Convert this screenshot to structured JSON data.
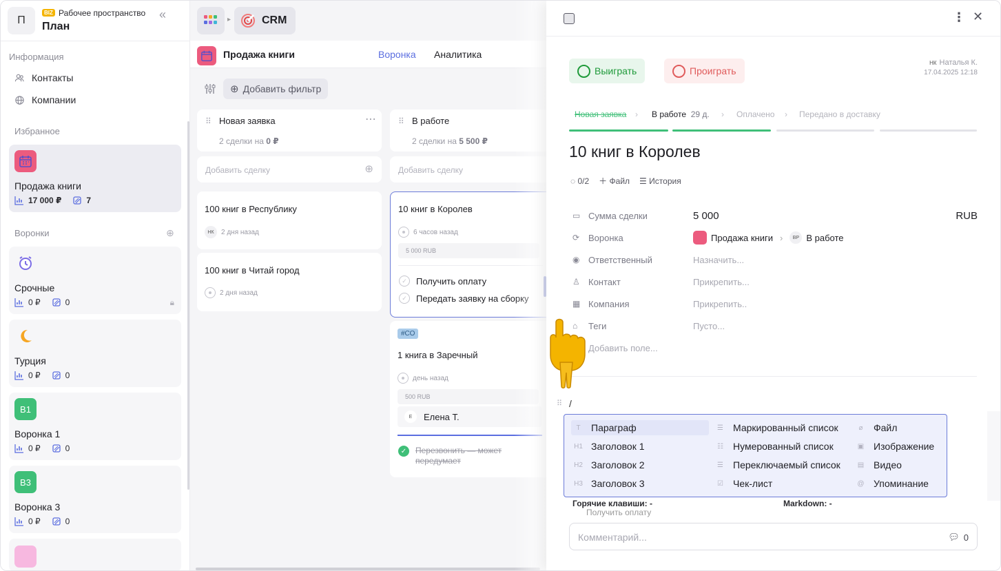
{
  "workspace": {
    "avatar": "П",
    "badge": "BIZ",
    "label": "Рабочее пространство",
    "name": "План"
  },
  "sidebar": {
    "info_section": "Информация",
    "nav": [
      {
        "label": "Контакты",
        "icon": "people-icon"
      },
      {
        "label": "Компании",
        "icon": "globe-icon"
      }
    ],
    "favorites_section": "Избранное",
    "favorite": {
      "name": "Продажа книги",
      "amount": "17 000 ₽",
      "count": "7"
    },
    "pipelines_section": "Воронки",
    "pipelines": [
      {
        "name": "Срочные",
        "amount": "0 ₽",
        "count": "0"
      },
      {
        "name": "Турция",
        "amount": "0 ₽",
        "count": "0"
      },
      {
        "name": "Воронка 1",
        "badge": "В1",
        "amount": "0 ₽",
        "count": "0"
      },
      {
        "name": "Воронка 3",
        "badge": "В3",
        "amount": "0 ₽",
        "count": "0"
      }
    ]
  },
  "topbar": {
    "app": "CRM"
  },
  "pipeline": {
    "title": "Продажа книги",
    "tabs": [
      "Воронка",
      "Аналитика"
    ]
  },
  "filter": {
    "add_label": "Добавить фильтр"
  },
  "columns": [
    {
      "title": "Новая заявка",
      "summary": "2 сделки на ",
      "summary_bold": "0 ₽",
      "add": "Добавить сделку",
      "deals": [
        {
          "title": "100 книг в Республику",
          "avatar": "НК",
          "time": "2 дня назад"
        },
        {
          "title": "100 книг в Читай город",
          "time": "2 дня назад"
        }
      ]
    },
    {
      "title": "В работе",
      "summary": "2 сделки на ",
      "summary_bold": "5 500 ₽",
      "add": "Добавить сделку",
      "deals": [
        {
          "title": "10 книг в Королев",
          "time": "6 часов назад",
          "amount": "5 000 RUB",
          "tasks": [
            "Получить оплату",
            "Передать заявку на сборку"
          ]
        },
        {
          "tag": "#СО",
          "title": "1 книга в Заречный",
          "time": "день назад",
          "amount": "500 RUB",
          "assignee_av": "Е",
          "assignee": "Елена Т.",
          "done_task": "Перезвонить — может передумает"
        }
      ]
    }
  ],
  "panel": {
    "win": "Выиграть",
    "lose": "Проиграть",
    "author_initials": "НК",
    "author": "Наталья К.",
    "date": "17.04.2025 12:18",
    "stages": [
      {
        "label": "Новая заявка",
        "state": "done"
      },
      {
        "label": "В работе",
        "extra": "29 д.",
        "state": "current"
      },
      {
        "label": "Оплачено",
        "state": "todo"
      },
      {
        "label": "Передано в доставку",
        "state": "todo"
      }
    ],
    "title": "10 книг в Королев",
    "actions": {
      "tasks": "0/2",
      "file": "Файл",
      "history": "История"
    },
    "fields": [
      {
        "label": "Сумма сделки",
        "value": "5 000",
        "currency": "RUB"
      },
      {
        "label": "Воронка",
        "pipeline": "Продажа книги",
        "stage_av": "ВР",
        "stage": "В работе"
      },
      {
        "label": "Ответственный",
        "value": "Назначить..."
      },
      {
        "label": "Контакт",
        "value": "Прикрепить..."
      },
      {
        "label": "Компания",
        "value": "Прикрепить.."
      },
      {
        "label": "Теги",
        "value": "Пусто..."
      },
      {
        "label": "Добавить поле..."
      }
    ],
    "slash": "/",
    "menu": {
      "col1": [
        "Параграф",
        "Заголовок 1",
        "Заголовок 2",
        "Заголовок 3"
      ],
      "col2": [
        "Маркированный список",
        "Нумерованный список",
        "Переключаемый список",
        "Чек-лист"
      ],
      "col3": [
        "Файл",
        "Изображение",
        "Видео",
        "Упоминание"
      ]
    },
    "hotkeys": "Горячие клавиши:  -",
    "markdown": "Markdown:  -",
    "behind_task": "Получить оплату",
    "comment_placeholder": "Комментарий...",
    "comment_count": "0"
  },
  "colors": {
    "accent": "#5b6ee0",
    "win": "#1f9a3a",
    "lose": "#e05b5b",
    "pipeline_icon": "#ec5b7e"
  }
}
